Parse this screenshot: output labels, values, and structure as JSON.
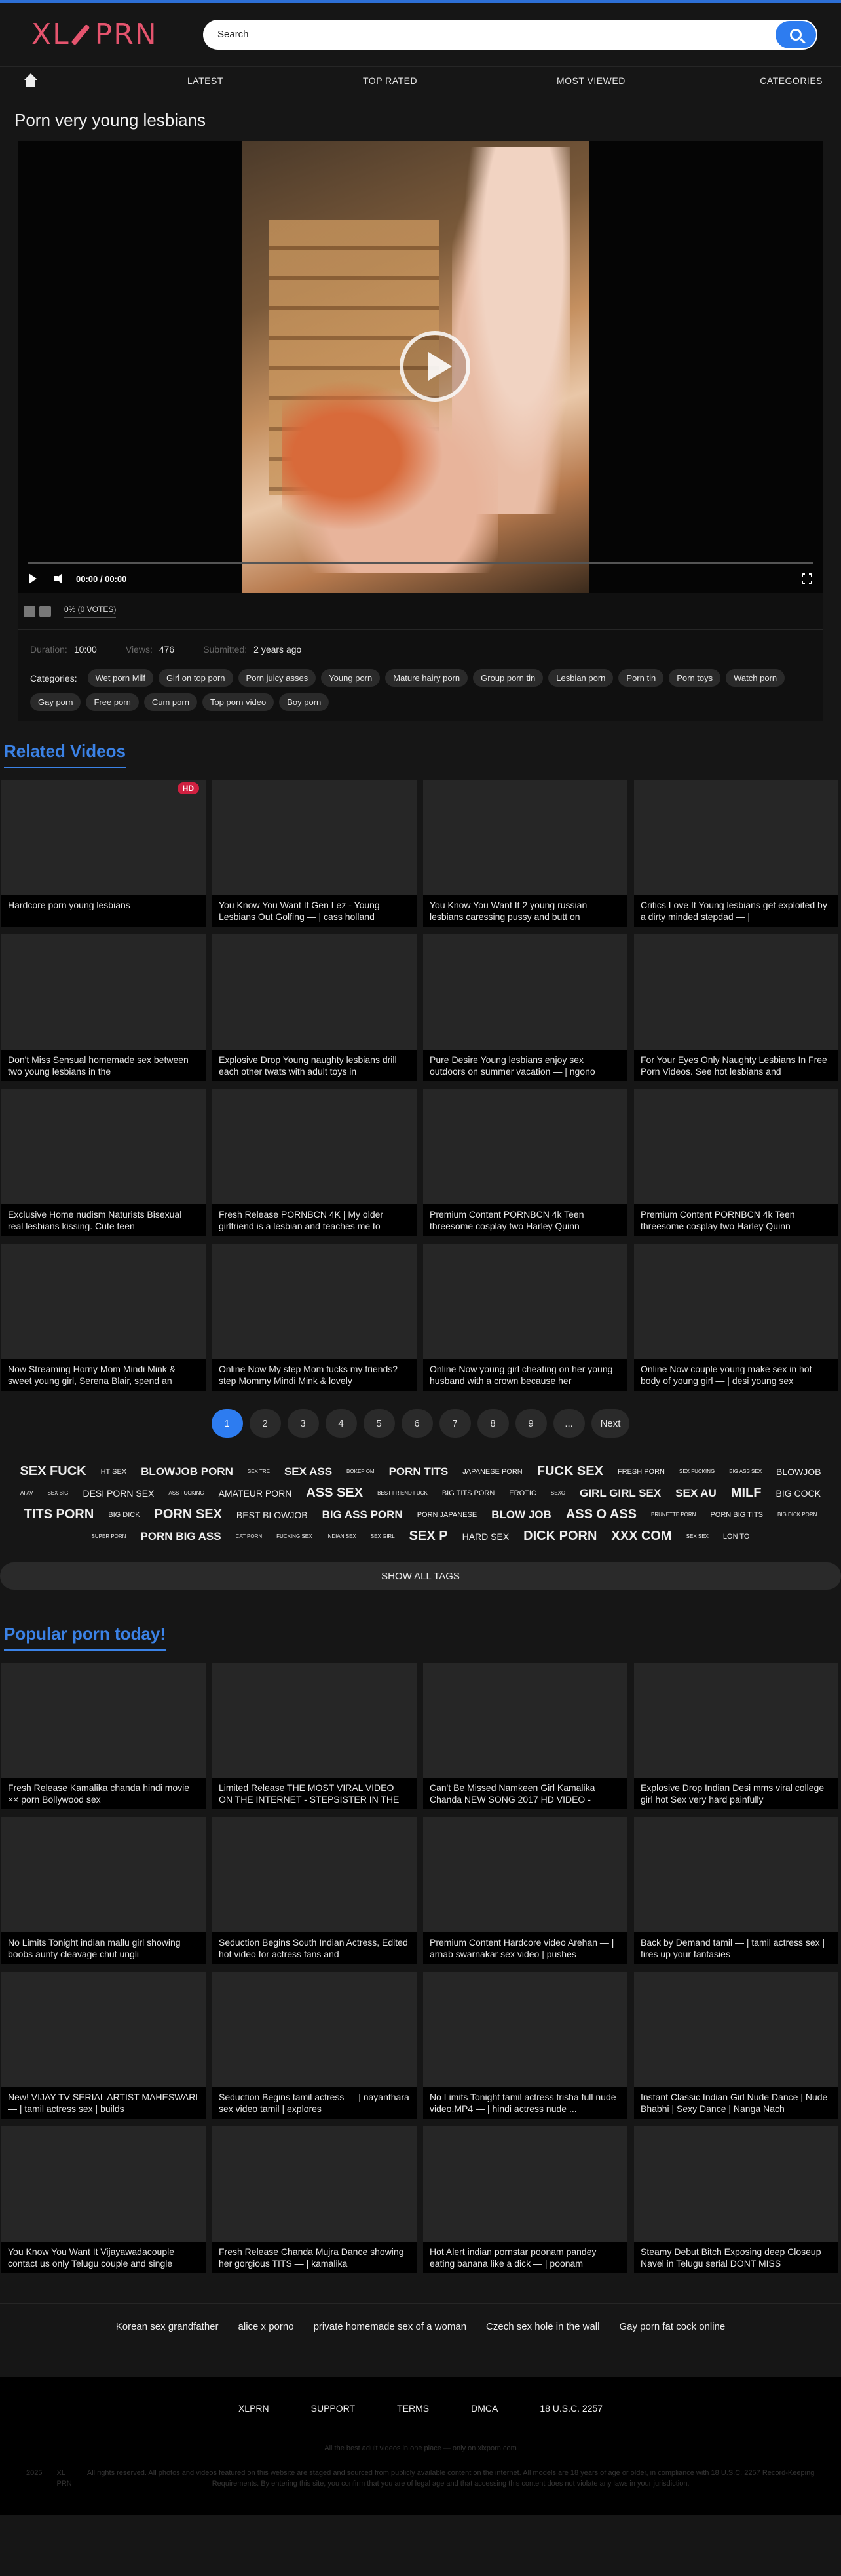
{
  "brand": {
    "logo_left": "XL",
    "logo_right": "PRN"
  },
  "search": {
    "placeholder": "Search"
  },
  "nav": {
    "latest": "LATEST",
    "top_rated": "TOP RATED",
    "most_viewed": "MOST VIEWED",
    "categories": "CATEGORIES"
  },
  "video": {
    "title": "Porn very young lesbians",
    "time": "00:00 / 00:00",
    "progress": 0,
    "votes": "0% (0 VOTES)",
    "duration_label": "Duration:",
    "duration": "10:00",
    "views_label": "Views:",
    "views": "476",
    "submitted_label": "Submitted:",
    "submitted": "2 years ago",
    "categories_label": "Categories:",
    "categories": [
      "Wet porn Milf",
      "Girl on top porn",
      "Porn juicy asses",
      "Young porn",
      "Mature hairy porn",
      "Group porn tin",
      "Lesbian porn",
      "Porn tin",
      "Porn toys",
      "Watch porn",
      "Gay porn",
      "Free porn",
      "Cum porn",
      "Top porn video",
      "Boy porn"
    ]
  },
  "related": {
    "title": "Related Videos",
    "items": [
      {
        "caption": "Hardcore porn young lesbians",
        "badge": "HD"
      },
      {
        "caption": "You Know You Want It Gen Lez - Young Lesbians Out Golfing — | cass holland",
        "badge": ""
      },
      {
        "caption": "You Know You Want It 2 young russian lesbians caressing pussy and butt on",
        "badge": ""
      },
      {
        "caption": "Critics Love It Young lesbians get exploited by a dirty minded stepdad — |",
        "badge": ""
      },
      {
        "caption": "Don't Miss Sensual homemade sex between two young lesbians in the",
        "badge": ""
      },
      {
        "caption": "Explosive Drop Young naughty lesbians drill each other twats with adult toys in",
        "badge": ""
      },
      {
        "caption": "Pure Desire Young lesbians enjoy sex outdoors on summer vacation — | ngono",
        "badge": ""
      },
      {
        "caption": "For Your Eyes Only Naughty Lesbians In Free Porn Videos. See hot lesbians and",
        "badge": ""
      },
      {
        "caption": "Exclusive Home nudism Naturists Bisexual real lesbians kissing. Cute teen",
        "badge": ""
      },
      {
        "caption": "Fresh Release PORNBCN 4K | My older girlfriend is a lesbian and teaches me to",
        "badge": ""
      },
      {
        "caption": "Premium Content PORNBCN 4k Teen threesome cosplay two Harley Quinn",
        "badge": ""
      },
      {
        "caption": "Premium Content PORNBCN 4k Teen threesome cosplay two Harley Quinn",
        "badge": ""
      },
      {
        "caption": "Now Streaming Horny Mom Mindi Mink & sweet young girl, Serena Blair, spend an",
        "badge": ""
      },
      {
        "caption": "Online Now My step Mom fucks my friends? step Mommy Mindi Mink & lovely",
        "badge": ""
      },
      {
        "caption": "Online Now young girl cheating on her young husband with a crown because her",
        "badge": ""
      },
      {
        "caption": "Online Now couple young make sex in hot body of young girl — | desi young sex",
        "badge": ""
      }
    ]
  },
  "pagination": {
    "pages": [
      "1",
      "2",
      "3",
      "4",
      "5",
      "6",
      "7",
      "8",
      "9",
      "..."
    ],
    "next": "Next",
    "active": "1"
  },
  "tags": [
    {
      "t": "SEX FUCK",
      "s": "xl"
    },
    {
      "t": "HT SEX",
      "s": "s"
    },
    {
      "t": "BLOWJOB PORN",
      "s": "l"
    },
    {
      "t": "SEX TRE",
      "s": "xs"
    },
    {
      "t": "SEX ASS",
      "s": "l"
    },
    {
      "t": "BOKEP OM",
      "s": "xs"
    },
    {
      "t": "PORN TITS",
      "s": "l"
    },
    {
      "t": "JAPANESE PORN",
      "s": "s"
    },
    {
      "t": "FUCK SEX",
      "s": "xl"
    },
    {
      "t": "FRESH PORN",
      "s": "s"
    },
    {
      "t": "SEX FUCKING",
      "s": "xs"
    },
    {
      "t": "BIG ASS SEX",
      "s": "xs"
    },
    {
      "t": "BLOWJOB",
      "s": "m"
    },
    {
      "t": "AI AV",
      "s": "xs"
    },
    {
      "t": "SEX BIG",
      "s": "xs"
    },
    {
      "t": "DESI PORN SEX",
      "s": "m"
    },
    {
      "t": "ASS FUCKING",
      "s": "xs"
    },
    {
      "t": "AMATEUR PORN",
      "s": "m"
    },
    {
      "t": "ASS SEX",
      "s": "xl"
    },
    {
      "t": "BEST FRIEND FUCK",
      "s": "xs"
    },
    {
      "t": "BIG TITS PORN",
      "s": "s"
    },
    {
      "t": "EROTIC",
      "s": "s"
    },
    {
      "t": "SEXO",
      "s": "xs"
    },
    {
      "t": "GIRL GIRL SEX",
      "s": "l"
    },
    {
      "t": "SEX AU",
      "s": "l"
    },
    {
      "t": "MILF",
      "s": "xl"
    },
    {
      "t": "BIG COCK",
      "s": "m"
    },
    {
      "t": "TITS PORN",
      "s": "xl"
    },
    {
      "t": "BIG DICK",
      "s": "s"
    },
    {
      "t": "PORN SEX",
      "s": "xl"
    },
    {
      "t": "BEST BLOWJOB",
      "s": "m"
    },
    {
      "t": "BIG ASS PORN",
      "s": "l"
    },
    {
      "t": "PORN JAPANESE",
      "s": "s"
    },
    {
      "t": "BLOW JOB",
      "s": "l"
    },
    {
      "t": "ASS O ASS",
      "s": "xl"
    },
    {
      "t": "BRUNETTE PORN",
      "s": "xs"
    },
    {
      "t": "PORN BIG TITS",
      "s": "s"
    },
    {
      "t": "BIG DICK PORN",
      "s": "xs"
    },
    {
      "t": "SUPER PORN",
      "s": "xs"
    },
    {
      "t": "PORN BIG ASS",
      "s": "l"
    },
    {
      "t": "CAT PORN",
      "s": "xs"
    },
    {
      "t": "FUCKING SEX",
      "s": "xs"
    },
    {
      "t": "INDIAN SEX",
      "s": "xs"
    },
    {
      "t": "SEX GIRL",
      "s": "xs"
    },
    {
      "t": "SEX P",
      "s": "xl"
    },
    {
      "t": "HARD SEX",
      "s": "m"
    },
    {
      "t": "DICK PORN",
      "s": "xl"
    },
    {
      "t": "XXX COM",
      "s": "xl"
    },
    {
      "t": "SEX SEX",
      "s": "xs"
    },
    {
      "t": "LON TO",
      "s": "s"
    }
  ],
  "show_all_tags": "SHOW ALL TAGS",
  "popular": {
    "title": "Popular porn today!",
    "items": [
      {
        "caption": "Fresh Release Kamalika chanda hindi movie ×× porn Bollywood sex"
      },
      {
        "caption": "Limited Release THE MOST VIRAL VIDEO ON THE INTERNET - STEPSISTER IN THE"
      },
      {
        "caption": "Can't Be Missed Namkeen Girl Kamalika Chanda NEW SONG 2017 HD VIDEO -"
      },
      {
        "caption": "Explosive Drop Indian Desi mms viral college girl hot Sex very hard painfully"
      },
      {
        "caption": "No Limits Tonight indian mallu girl showing boobs aunty cleavage chut ungli"
      },
      {
        "caption": "Seduction Begins South Indian Actress, Edited hot video for actress fans and"
      },
      {
        "caption": "Premium Content Hardcore video Arehan — | arnab swarnakar sex video | pushes"
      },
      {
        "caption": "Back by Demand tamil — | tamil actress sex | fires up your fantasies"
      },
      {
        "caption": "New! VIJAY TV SERIAL ARTIST MAHESWARI — | tamil actress sex | builds"
      },
      {
        "caption": "Seduction Begins tamil actress — | nayanthara sex video tamil | explores"
      },
      {
        "caption": "No Limits Tonight tamil actress trisha full nude video.MP4 — | hindi actress nude ..."
      },
      {
        "caption": "Instant Classic Indian Girl Nude Dance | Nude Bhabhi | Sexy Dance | Nanga Nach"
      },
      {
        "caption": "You Know You Want It Vijayawadacouple contact us only Telugu couple and single"
      },
      {
        "caption": "Fresh Release Chanda Mujra Dance showing her gorgious TITS — | kamalika"
      },
      {
        "caption": "Hot Alert indian pornstar poonam pandey eating banana like a dick — | poonam"
      },
      {
        "caption": "Steamy Debut Bitch Exposing deep Closeup Navel in Telugu serial DONT MISS"
      }
    ]
  },
  "bottom_links": [
    "Korean sex grandfather",
    "alice x porno",
    "private homemade sex of a woman",
    "Czech sex hole in the wall",
    "Gay porn fat cock online"
  ],
  "footer": {
    "nav": [
      "XLPRN",
      "SUPPORT",
      "TERMS",
      "DMCA",
      "18 U.S.C. 2257"
    ],
    "tagline": "All the best adult videos in one place — only on xlxporn.com",
    "year": "2025",
    "brand": "XL PRN",
    "legal": "All rights reserved. All photos and videos featured on this website are staged and sourced from publicly available content on the internet. All models are 18 years of age or older, in compliance with 18 U.S.C. 2257 Record-Keeping Requirements. By entering this site, you confirm that you are of legal age and that accessing this content does not violate any laws in your jurisdiction.",
    "colors": {
      "accent": "#2d7cf0",
      "logo": "#e5546e"
    }
  }
}
